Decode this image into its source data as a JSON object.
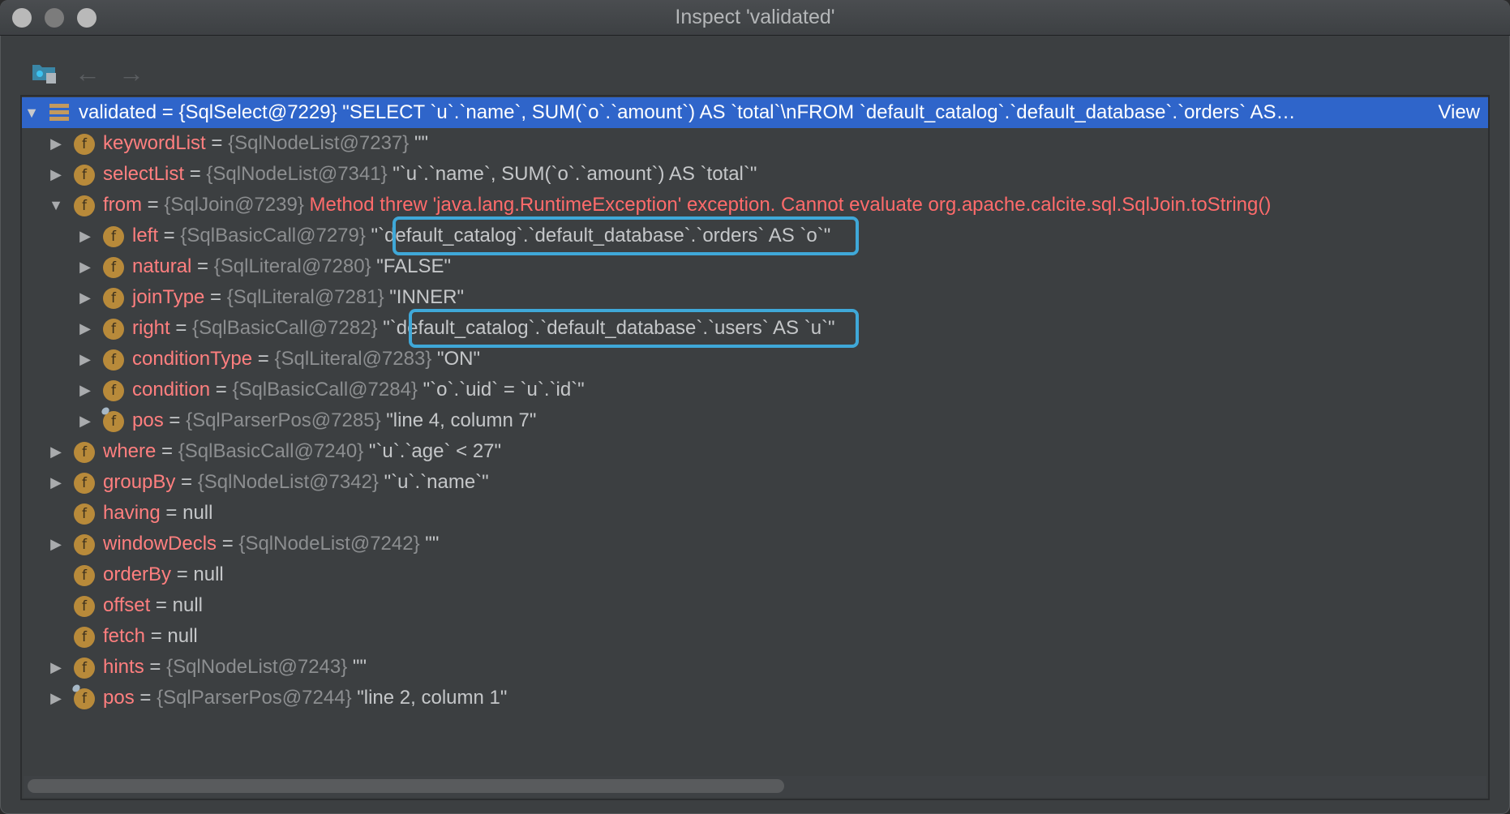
{
  "window": {
    "title": "Inspect 'validated'",
    "buttons": [
      "close",
      "minimize",
      "maximize"
    ]
  },
  "toolbar": {
    "items": [
      {
        "icon": "folder-watch-icon",
        "label": "Inspect"
      },
      {
        "icon": "arrow-left-icon",
        "label": "←"
      },
      {
        "icon": "arrow-right-icon",
        "label": "→"
      }
    ]
  },
  "tree": {
    "root": {
      "name": "validated",
      "eq": " = ",
      "type": "{SqlSelect@7229}",
      "value": " \"SELECT `u`.`name`, SUM(`o`.`amount`) AS `total`\\nFROM `default_catalog`.`default_database`.`orders` AS…",
      "view_link": "View",
      "expanded": true
    },
    "rows": [
      {
        "level": 1,
        "expandable": true,
        "expanded": false,
        "name": "keywordList",
        "eq": " = ",
        "type": "{SqlNodeList@7237}",
        "value": " \"\""
      },
      {
        "level": 1,
        "expandable": true,
        "expanded": false,
        "name": "selectList",
        "eq": " = ",
        "type": "{SqlNodeList@7341}",
        "value": " \"`u`.`name`, SUM(`o`.`amount`) AS `total`\""
      },
      {
        "level": 1,
        "expandable": true,
        "expanded": true,
        "name": "from",
        "eq": " = ",
        "type": "{SqlJoin@7239}",
        "error": " Method threw 'java.lang.RuntimeException' exception. Cannot evaluate org.apache.calcite.sql.SqlJoin.toString()"
      },
      {
        "level": 2,
        "expandable": true,
        "expanded": false,
        "name": "left",
        "eq": " = ",
        "type": "{SqlBasicCall@7279}",
        "value": " \"`default_catalog`.`default_database`.`orders` AS `o`\"",
        "highlighted": true
      },
      {
        "level": 2,
        "expandable": true,
        "expanded": false,
        "name": "natural",
        "eq": " = ",
        "type": "{SqlLiteral@7280}",
        "value": " \"FALSE\""
      },
      {
        "level": 2,
        "expandable": true,
        "expanded": false,
        "name": "joinType",
        "eq": " = ",
        "type": "{SqlLiteral@7281}",
        "value": " \"INNER\""
      },
      {
        "level": 2,
        "expandable": true,
        "expanded": false,
        "name": "right",
        "eq": " = ",
        "type": "{SqlBasicCall@7282}",
        "value": " \"`default_catalog`.`default_database`.`users` AS `u`\"",
        "highlighted": true
      },
      {
        "level": 2,
        "expandable": true,
        "expanded": false,
        "name": "conditionType",
        "eq": " = ",
        "type": "{SqlLiteral@7283}",
        "value": " \"ON\""
      },
      {
        "level": 2,
        "expandable": true,
        "expanded": false,
        "name": "condition",
        "eq": " = ",
        "type": "{SqlBasicCall@7284}",
        "value": " \"`o`.`uid` = `u`.`id`\""
      },
      {
        "level": 2,
        "expandable": true,
        "expanded": false,
        "name": "pos",
        "eq": " = ",
        "type": "{SqlParserPos@7285}",
        "value": " \"line 4, column 7\"",
        "watch_badge": true
      },
      {
        "level": 1,
        "expandable": true,
        "expanded": false,
        "name": "where",
        "eq": " = ",
        "type": "{SqlBasicCall@7240}",
        "value": " \"`u`.`age` < 27\""
      },
      {
        "level": 1,
        "expandable": true,
        "expanded": false,
        "name": "groupBy",
        "eq": " = ",
        "type": "{SqlNodeList@7342}",
        "value": " \"`u`.`name`\""
      },
      {
        "level": 1,
        "expandable": false,
        "name": "having",
        "eq": " = ",
        "type": "",
        "value": "null"
      },
      {
        "level": 1,
        "expandable": true,
        "expanded": false,
        "name": "windowDecls",
        "eq": " = ",
        "type": "{SqlNodeList@7242}",
        "value": " \"\""
      },
      {
        "level": 1,
        "expandable": false,
        "name": "orderBy",
        "eq": " = ",
        "type": "",
        "value": "null"
      },
      {
        "level": 1,
        "expandable": false,
        "name": "offset",
        "eq": " = ",
        "type": "",
        "value": "null"
      },
      {
        "level": 1,
        "expandable": false,
        "name": "fetch",
        "eq": " = ",
        "type": "",
        "value": "null"
      },
      {
        "level": 1,
        "expandable": true,
        "expanded": false,
        "name": "hints",
        "eq": " = ",
        "type": "{SqlNodeList@7243}",
        "value": " \"\""
      },
      {
        "level": 1,
        "expandable": true,
        "expanded": false,
        "name": "pos",
        "eq": " = ",
        "type": "{SqlParserPos@7244}",
        "value": " \"line 2, column 1\"",
        "watch_badge": true
      }
    ],
    "field_icon_glyph": "f",
    "expanded_glyph": "▼",
    "collapsed_glyph": "▶"
  },
  "colors": {
    "selection": "#2f65ca",
    "field_name": "#ff7f7f",
    "error": "#ff6b6b",
    "highlight_box": "#3fa8d8",
    "field_icon": "#b88a3a"
  },
  "scrollbar": {
    "horizontal_position_fraction": 0.0,
    "visible_fraction": 0.52
  }
}
